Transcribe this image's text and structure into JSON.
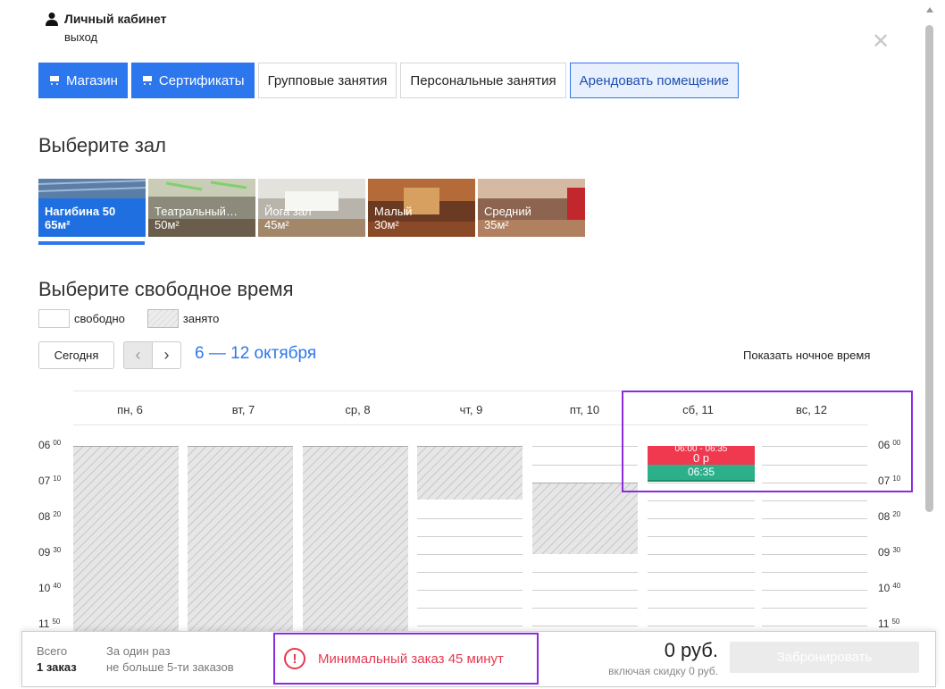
{
  "header": {
    "account_label": "Личный кабинет",
    "logout_label": "выход",
    "close_icon": "✕"
  },
  "tabs": [
    {
      "label": "Магазин",
      "style": "blue",
      "icon": "cart-icon"
    },
    {
      "label": "Сертификаты",
      "style": "blue",
      "icon": "cart-icon"
    },
    {
      "label": "Групповые занятия",
      "style": "plain"
    },
    {
      "label": "Персональные занятия",
      "style": "plain"
    },
    {
      "label": "Арендовать помещение",
      "style": "active"
    }
  ],
  "halls_section": {
    "title": "Выберите зал",
    "halls": [
      {
        "name": "Нагибина 50",
        "size": "65м²",
        "selected": true
      },
      {
        "name": "Театральный…",
        "size": "50м²",
        "selected": false
      },
      {
        "name": "Йога зал",
        "size": "45м²",
        "selected": false
      },
      {
        "name": "Малый",
        "size": "30м²",
        "selected": false
      },
      {
        "name": "Средний",
        "size": "35м²",
        "selected": false
      }
    ]
  },
  "time_section": {
    "title": "Выберите свободное время",
    "legend_free": "свободно",
    "legend_busy": "занято",
    "today_label": "Сегодня",
    "prev_icon": "‹",
    "next_icon": "›",
    "range": "6 — 12 октября",
    "night_toggle": "Показать ночное время"
  },
  "calendar": {
    "days": [
      "пн, 6",
      "вт, 7",
      "ср, 8",
      "чт, 9",
      "пт, 10",
      "сб, 11",
      "вс, 12"
    ],
    "times": [
      {
        "h": "06",
        "m": "00"
      },
      {
        "h": "07",
        "m": "10"
      },
      {
        "h": "08",
        "m": "20"
      },
      {
        "h": "09",
        "m": "30"
      },
      {
        "h": "10",
        "m": "40"
      },
      {
        "h": "11",
        "m": "50"
      }
    ],
    "event_red_time": "06:00 - 06:35",
    "event_red_price": "0 р",
    "event_green": "06:35"
  },
  "bottom_bar": {
    "total_label": "Всего",
    "total_value": "1 заказ",
    "once_label": "За один раз",
    "once_value": "не больше 5-ти заказов",
    "warning": "Минимальный заказ 45 минут",
    "warning_icon": "!",
    "price": "0 руб.",
    "discount": "включая скидку 0 руб.",
    "book_button": "Забронировать"
  }
}
